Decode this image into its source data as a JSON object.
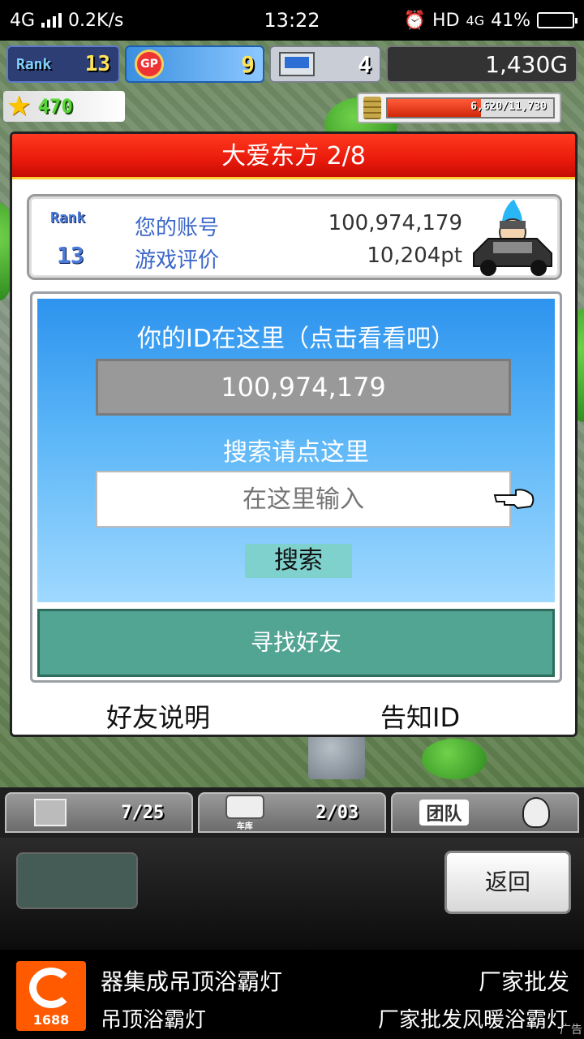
{
  "status_bar": {
    "network": "4G",
    "speed": "0.2K/s",
    "time": "13:22",
    "hd": "HD",
    "net2": "4G",
    "battery": "41%",
    "battery_level": 0.41
  },
  "hud": {
    "rank_label": "Rank",
    "rank_value": "13",
    "gp_label": "GP",
    "gp_value": "9",
    "pc_value": "4",
    "money": "1,430G",
    "stars": "470",
    "coins": "6,620/11,730",
    "coin_fraction": 0.564
  },
  "dialog": {
    "title": "大爱东方 2/8",
    "rank_label": "Rank",
    "rank_value": "13",
    "account_label": "您的账号",
    "account_value": "100,974,179",
    "rating_label": "游戏评价",
    "rating_value": "10,204pt",
    "id_heading": "你的ID在这里（点击看看吧）",
    "id_value": "100,974,179",
    "search_heading": "搜索请点这里",
    "search_placeholder": "在这里输入",
    "search_button": "搜索",
    "find_friends_button": "寻找好友",
    "friend_help_link": "好友说明",
    "tell_id_link": "告知ID"
  },
  "tabs": {
    "tab1_count": "7/25",
    "tab2_label": "车库",
    "tab2_count": "2/03",
    "tab3_label": "团队"
  },
  "bottom": {
    "back_button": "返回"
  },
  "ad": {
    "logo_text": "1688",
    "line1_left": "器集成吊顶浴霸灯",
    "line1_right": "厂家批发",
    "line2_left": "吊顶浴霸灯",
    "line2_right": "厂家批发风暖浴霸灯",
    "tag": "广告"
  }
}
